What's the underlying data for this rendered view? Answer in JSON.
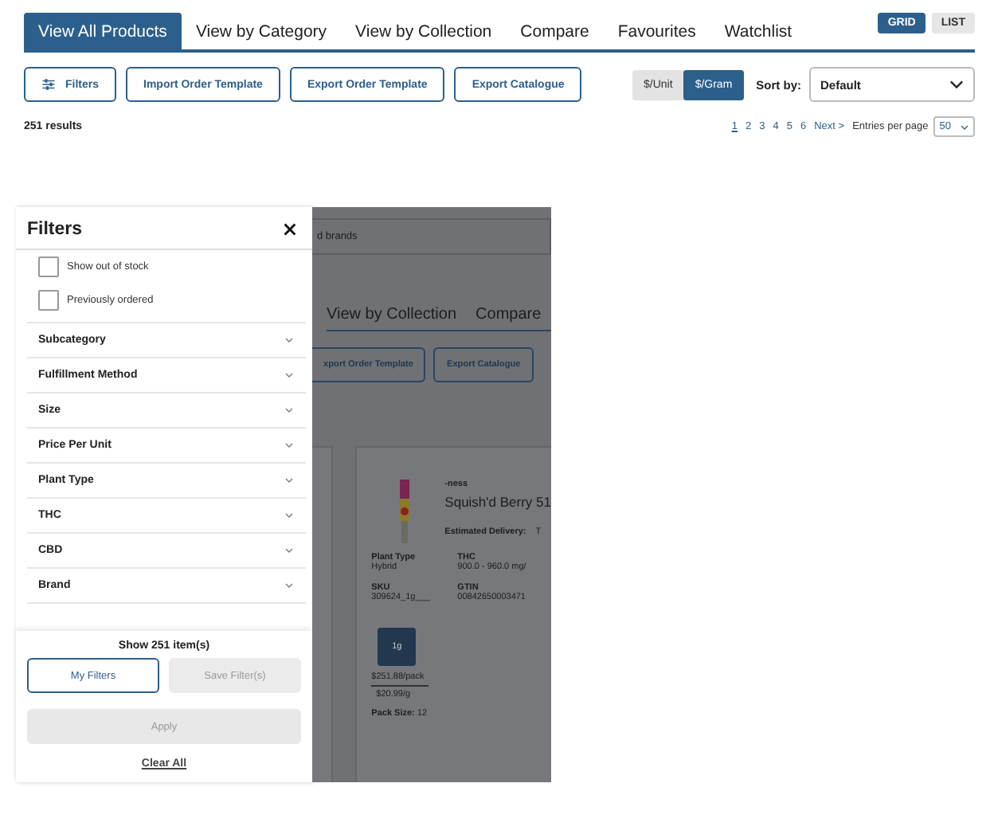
{
  "tabs": [
    {
      "label": "View All Products",
      "selected": true
    },
    {
      "label": "View by Category",
      "selected": false
    },
    {
      "label": "View by Collection",
      "selected": false
    },
    {
      "label": "Compare",
      "selected": false
    },
    {
      "label": "Favourites",
      "selected": false
    },
    {
      "label": "Watchlist",
      "selected": false
    }
  ],
  "view_toggle": [
    {
      "label": "GRID",
      "selected": true
    },
    {
      "label": "LIST",
      "selected": false
    }
  ],
  "toolbar": [
    {
      "label": "Filters",
      "kind": "filter"
    },
    {
      "label": "Import Order Template",
      "kind": "plain"
    },
    {
      "label": "Export Order Template",
      "kind": "plain"
    },
    {
      "label": "Export Catalogue",
      "kind": "plain"
    }
  ],
  "price_toggle": [
    {
      "label": "$/Unit",
      "selected": false
    },
    {
      "label": "$/Gram",
      "selected": true
    }
  ],
  "sort": {
    "label": "Sort by:",
    "value": "Default"
  },
  "results": "251 results",
  "pagination": {
    "pages": [
      {
        "label": "1",
        "selected": true
      },
      {
        "label": "2",
        "selected": false
      },
      {
        "label": "3",
        "selected": false
      },
      {
        "label": "4",
        "selected": false
      },
      {
        "label": "5",
        "selected": false
      },
      {
        "label": "6",
        "selected": false
      }
    ],
    "next": "Next >",
    "entries_label": "Entries per page",
    "entries_value": "50"
  },
  "mobile_view": {
    "filter_panel": {
      "title": "Filters",
      "checkboxes": [
        {
          "label": "Show out of stock",
          "checked": false
        },
        {
          "label": "Previously ordered",
          "checked": false
        }
      ],
      "sections": [
        "Subcategory",
        "Fulfillment Method",
        "Size",
        "Price Per Unit",
        "Plant Type",
        "THC",
        "CBD",
        "Brand"
      ],
      "show_count": "Show 251 item(s)",
      "buttons": [
        {
          "label": "My Filters",
          "disabled": false
        },
        {
          "label": "Save Filter(s)",
          "disabled": true
        }
      ],
      "apply": {
        "label": "Apply",
        "disabled": true
      },
      "clear": "Clear All"
    },
    "background": {
      "search_placeholder": "d brands",
      "tabs": [
        "View by Collection",
        "Compare"
      ],
      "buttons": [
        "xport Order Template",
        "Export Catalogue"
      ],
      "product": {
        "brand": "-ness",
        "name": "Squish'd Berry 51",
        "delivery_label": "Estimated Delivery:",
        "delivery_value": "T",
        "attributes": [
          {
            "label": "Plant Type",
            "value": "Hybrid"
          },
          {
            "label": "THC",
            "value": "900.0 - 960.0 mg/"
          },
          {
            "label": "SKU",
            "value": "309624_1g___"
          },
          {
            "label": "GTIN",
            "value": "00842650003471"
          }
        ],
        "size": "1g",
        "price_pack": "$251.88/pack",
        "price_gram": "$20.99/g",
        "pack_size": "**Pack Size:** 12"
      }
    }
  }
}
